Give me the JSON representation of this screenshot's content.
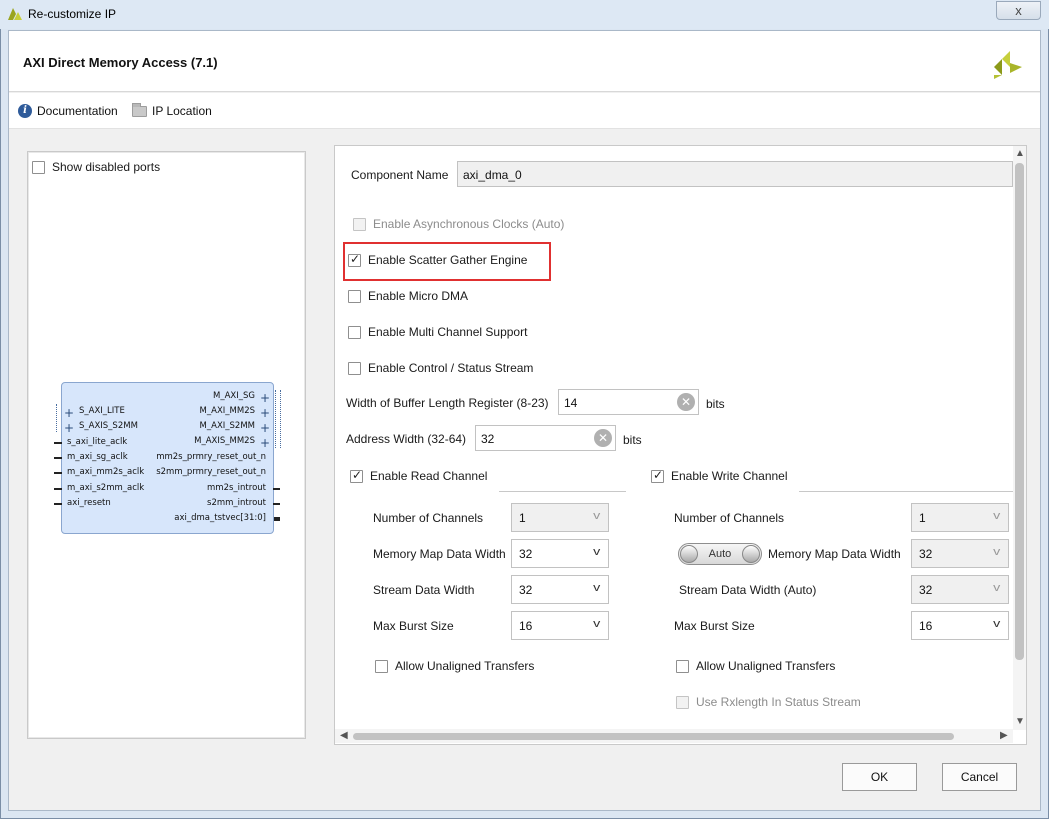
{
  "window": {
    "title": "Re-customize IP",
    "close_label": "x"
  },
  "header": {
    "title": "AXI Direct Memory Access (7.1)"
  },
  "toolbar": {
    "documentation": "Documentation",
    "ip_location": "IP Location"
  },
  "left_pane": {
    "show_disabled_ports": {
      "label": "Show disabled ports",
      "checked": false
    },
    "symbol": {
      "left_ports": [
        "S_AXI_LITE",
        "S_AXIS_S2MM",
        "s_axi_lite_aclk",
        "m_axi_sg_aclk",
        "m_axi_mm2s_aclk",
        "m_axi_s2mm_aclk",
        "axi_resetn"
      ],
      "right_ports": [
        "M_AXI_SG",
        "M_AXI_MM2S",
        "M_AXI_S2MM",
        "M_AXIS_MM2S",
        "mm2s_prmry_reset_out_n",
        "s2mm_prmry_reset_out_n",
        "mm2s_introut",
        "s2mm_introut",
        "axi_dma_tstvec[31:0]"
      ]
    }
  },
  "form": {
    "component_name_label": "Component Name",
    "component_name_value": "axi_dma_0",
    "enable_async_clocks": {
      "label": "Enable Asynchronous Clocks (Auto)",
      "checked": false,
      "enabled": false
    },
    "enable_sg": {
      "label": "Enable Scatter Gather Engine",
      "checked": true
    },
    "enable_micro_dma": {
      "label": "Enable Micro DMA",
      "checked": false
    },
    "enable_multi_channel": {
      "label": "Enable Multi Channel Support",
      "checked": false
    },
    "enable_control_status": {
      "label": "Enable Control / Status Stream",
      "checked": false
    },
    "buffer_length_label": "Width of Buffer Length Register (8-23)",
    "buffer_length_value": "14",
    "buffer_length_unit": "bits",
    "address_width_label": "Address Width (32-64)",
    "address_width_value": "32",
    "address_width_unit": "bits",
    "read_channel": {
      "label": "Enable Read Channel",
      "checked": true,
      "num_channels_label": "Number of Channels",
      "num_channels": "1",
      "mm_data_width_label": "Memory Map Data Width",
      "mm_data_width": "32",
      "stream_width_label": "Stream Data Width",
      "stream_width": "32",
      "burst_label": "Max Burst Size",
      "burst": "16",
      "unaligned_label": "Allow Unaligned Transfers"
    },
    "write_channel": {
      "label": "Enable Write Channel",
      "checked": true,
      "num_channels_label": "Number of Channels",
      "num_channels": "1",
      "auto_toggle": "Auto",
      "mm_data_width_label": "Memory Map Data Width",
      "mm_data_width": "32",
      "stream_width_label": "Stream Data Width (Auto)",
      "stream_width": "32",
      "burst_label": "Max Burst Size",
      "burst": "16",
      "unaligned_label": "Allow Unaligned Transfers",
      "rxlength_label": "Use Rxlength In Status Stream"
    }
  },
  "buttons": {
    "ok": "OK",
    "cancel": "Cancel"
  },
  "colors": {
    "highlight": "#e03030",
    "symbol_fill": "#d7e6fb",
    "info_icon": "#2f5b9a"
  }
}
